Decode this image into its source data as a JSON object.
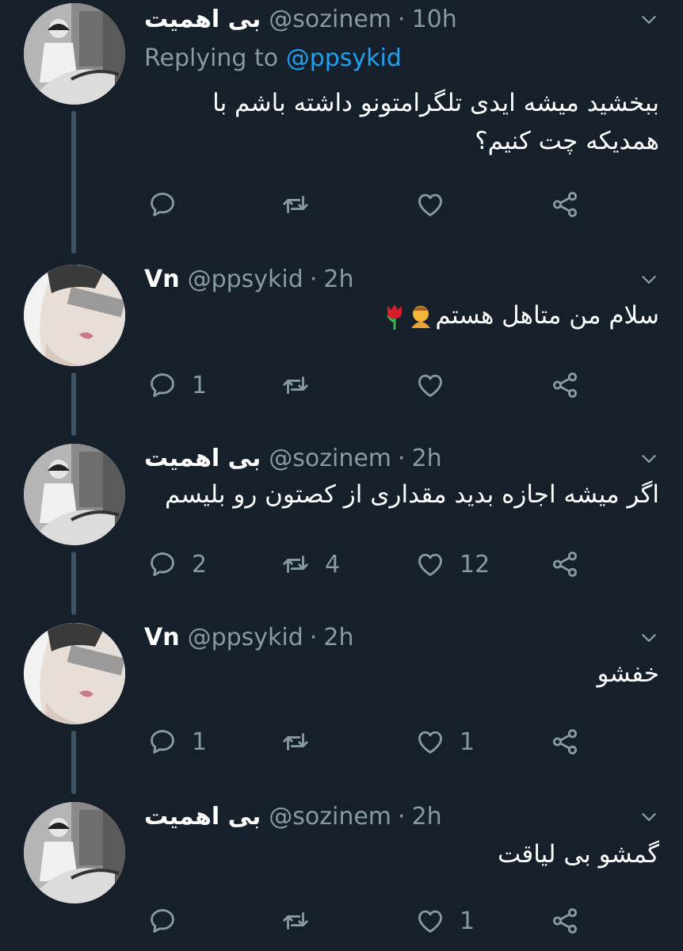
{
  "tweets": [
    {
      "name": "بی اهمیت",
      "handle": "@sozinem",
      "time": "10h",
      "replying_label": "Replying to",
      "replying_to": "@ppsykid",
      "text": "ببخشید میشه ایدی تلگرامتونو داشته باشم با همدیکه چت کنیم؟",
      "reply_count": "",
      "retweet_count": "",
      "like_count": ""
    },
    {
      "name": "Vn",
      "handle": "@ppsykid",
      "time": "2h",
      "text": "سلام من متاهل هستم",
      "emoji": [
        "person-bowing-emoji",
        "tulip-emoji"
      ],
      "reply_count": "1",
      "retweet_count": "",
      "like_count": ""
    },
    {
      "name": "بی اهمیت",
      "handle": "@sozinem",
      "time": "2h",
      "text": "اگر میشه اجازه بدید مقداری از کصتون رو بلیسم",
      "reply_count": "2",
      "retweet_count": "4",
      "like_count": "12"
    },
    {
      "name": "Vn",
      "handle": "@ppsykid",
      "time": "2h",
      "text": "خفشو",
      "reply_count": "1",
      "retweet_count": "",
      "like_count": "1"
    },
    {
      "name": "بی اهمیت",
      "handle": "@sozinem",
      "time": "2h",
      "text": "گمشو بی لیاقت",
      "reply_count": "",
      "retweet_count": "",
      "like_count": "1"
    }
  ],
  "colors": {
    "background": "#15202b",
    "secondary_text": "#8899a6",
    "link": "#1da1f2",
    "thread_line": "#3d5466"
  },
  "icons": [
    "chevron-down-icon",
    "reply-icon",
    "retweet-icon",
    "like-icon",
    "share-icon"
  ]
}
